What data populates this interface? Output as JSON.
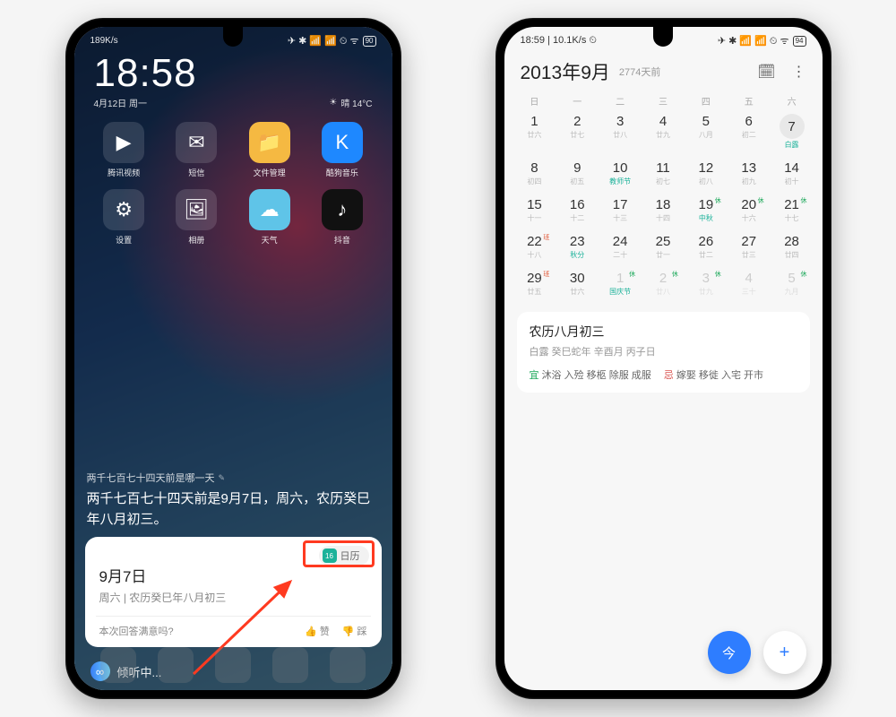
{
  "left": {
    "status": {
      "rate": "189K/s",
      "battery": "90"
    },
    "clock": {
      "time": "18:58",
      "date": "4月12日 周一",
      "weather": "晴 14°C"
    },
    "apps": {
      "row1": [
        {
          "label": "腾讯视频",
          "bg": "#ffffff22",
          "glyph": "▶"
        },
        {
          "label": "短信",
          "bg": "#ffffff22",
          "glyph": "✉"
        },
        {
          "label": "文件管理",
          "bg": "#f5b942",
          "glyph": "📁"
        },
        {
          "label": "酷狗音乐",
          "bg": "#1e88ff",
          "glyph": "K"
        }
      ],
      "row2": [
        {
          "label": "设置",
          "bg": "#ffffff22",
          "glyph": "⚙"
        },
        {
          "label": "相册",
          "bg": "#ffffff22",
          "glyph": "🖼"
        },
        {
          "label": "天气",
          "bg": "#5fc4e8",
          "glyph": "☁"
        },
        {
          "label": "抖音",
          "bg": "#111",
          "glyph": "♪"
        }
      ]
    },
    "assistant": {
      "question": "两千七百七十四天前是哪一天",
      "answer": "两千七百七十四天前是9月7日，周六，农历癸巳年八月初三。"
    },
    "card": {
      "pill_label": "日历",
      "date_title": "9月7日",
      "date_sub": "周六 | 农历癸巳年八月初三",
      "feedback_q": "本次回答满意吗?",
      "thumb_up": "赞",
      "thumb_down": "踩"
    },
    "listen": "倾听中..."
  },
  "right": {
    "status": {
      "time": "18:59",
      "rate": "10.1K/s",
      "battery": "94"
    },
    "title": "2013年9月",
    "days_ago": "2774天前",
    "weekdays": [
      "日",
      "一",
      "二",
      "三",
      "四",
      "五",
      "六"
    ],
    "grid": [
      {
        "n": "1",
        "s": "廿六"
      },
      {
        "n": "2",
        "s": "廿七"
      },
      {
        "n": "3",
        "s": "廿八"
      },
      {
        "n": "4",
        "s": "廿九"
      },
      {
        "n": "5",
        "s": "八月"
      },
      {
        "n": "6",
        "s": "初二"
      },
      {
        "n": "7",
        "s": "白露",
        "sel": true,
        "teal": true
      },
      {
        "n": "8",
        "s": "初四"
      },
      {
        "n": "9",
        "s": "初五"
      },
      {
        "n": "10",
        "s": "教师节",
        "teal": true
      },
      {
        "n": "11",
        "s": "初七"
      },
      {
        "n": "12",
        "s": "初八"
      },
      {
        "n": "13",
        "s": "初九"
      },
      {
        "n": "14",
        "s": "初十"
      },
      {
        "n": "15",
        "s": "十一"
      },
      {
        "n": "16",
        "s": "十二"
      },
      {
        "n": "17",
        "s": "十三"
      },
      {
        "n": "18",
        "s": "十四"
      },
      {
        "n": "19",
        "s": "中秋",
        "teal": true,
        "badge": "休",
        "bt": "rest"
      },
      {
        "n": "20",
        "s": "十六",
        "badge": "休",
        "bt": "rest"
      },
      {
        "n": "21",
        "s": "十七",
        "badge": "休",
        "bt": "rest"
      },
      {
        "n": "22",
        "s": "十八",
        "badge": "班",
        "bt": "work"
      },
      {
        "n": "23",
        "s": "秋分",
        "teal": true
      },
      {
        "n": "24",
        "s": "二十"
      },
      {
        "n": "25",
        "s": "廿一"
      },
      {
        "n": "26",
        "s": "廿二"
      },
      {
        "n": "27",
        "s": "廿三"
      },
      {
        "n": "28",
        "s": "廿四"
      },
      {
        "n": "29",
        "s": "廿五",
        "badge": "班",
        "bt": "work"
      },
      {
        "n": "30",
        "s": "廿六"
      },
      {
        "n": "1",
        "s": "国庆节",
        "faded": true,
        "teal": true,
        "badge": "休",
        "bt": "rest"
      },
      {
        "n": "2",
        "s": "廿八",
        "faded": true,
        "badge": "休",
        "bt": "rest"
      },
      {
        "n": "3",
        "s": "廿九",
        "faded": true,
        "badge": "休",
        "bt": "rest"
      },
      {
        "n": "4",
        "s": "三十",
        "faded": true
      },
      {
        "n": "5",
        "s": "九月",
        "faded": true,
        "badge": "休",
        "bt": "rest"
      }
    ],
    "detail": {
      "title": "农历八月初三",
      "sub": "白露 癸巳蛇年 辛酉月 丙子日",
      "good_label": "宜",
      "good": "沐浴 入殓 移柩 除服 成服",
      "bad_label": "忌",
      "bad": "嫁娶 移徙 入宅 开市"
    },
    "fab": {
      "today": "今",
      "add": "+"
    }
  }
}
